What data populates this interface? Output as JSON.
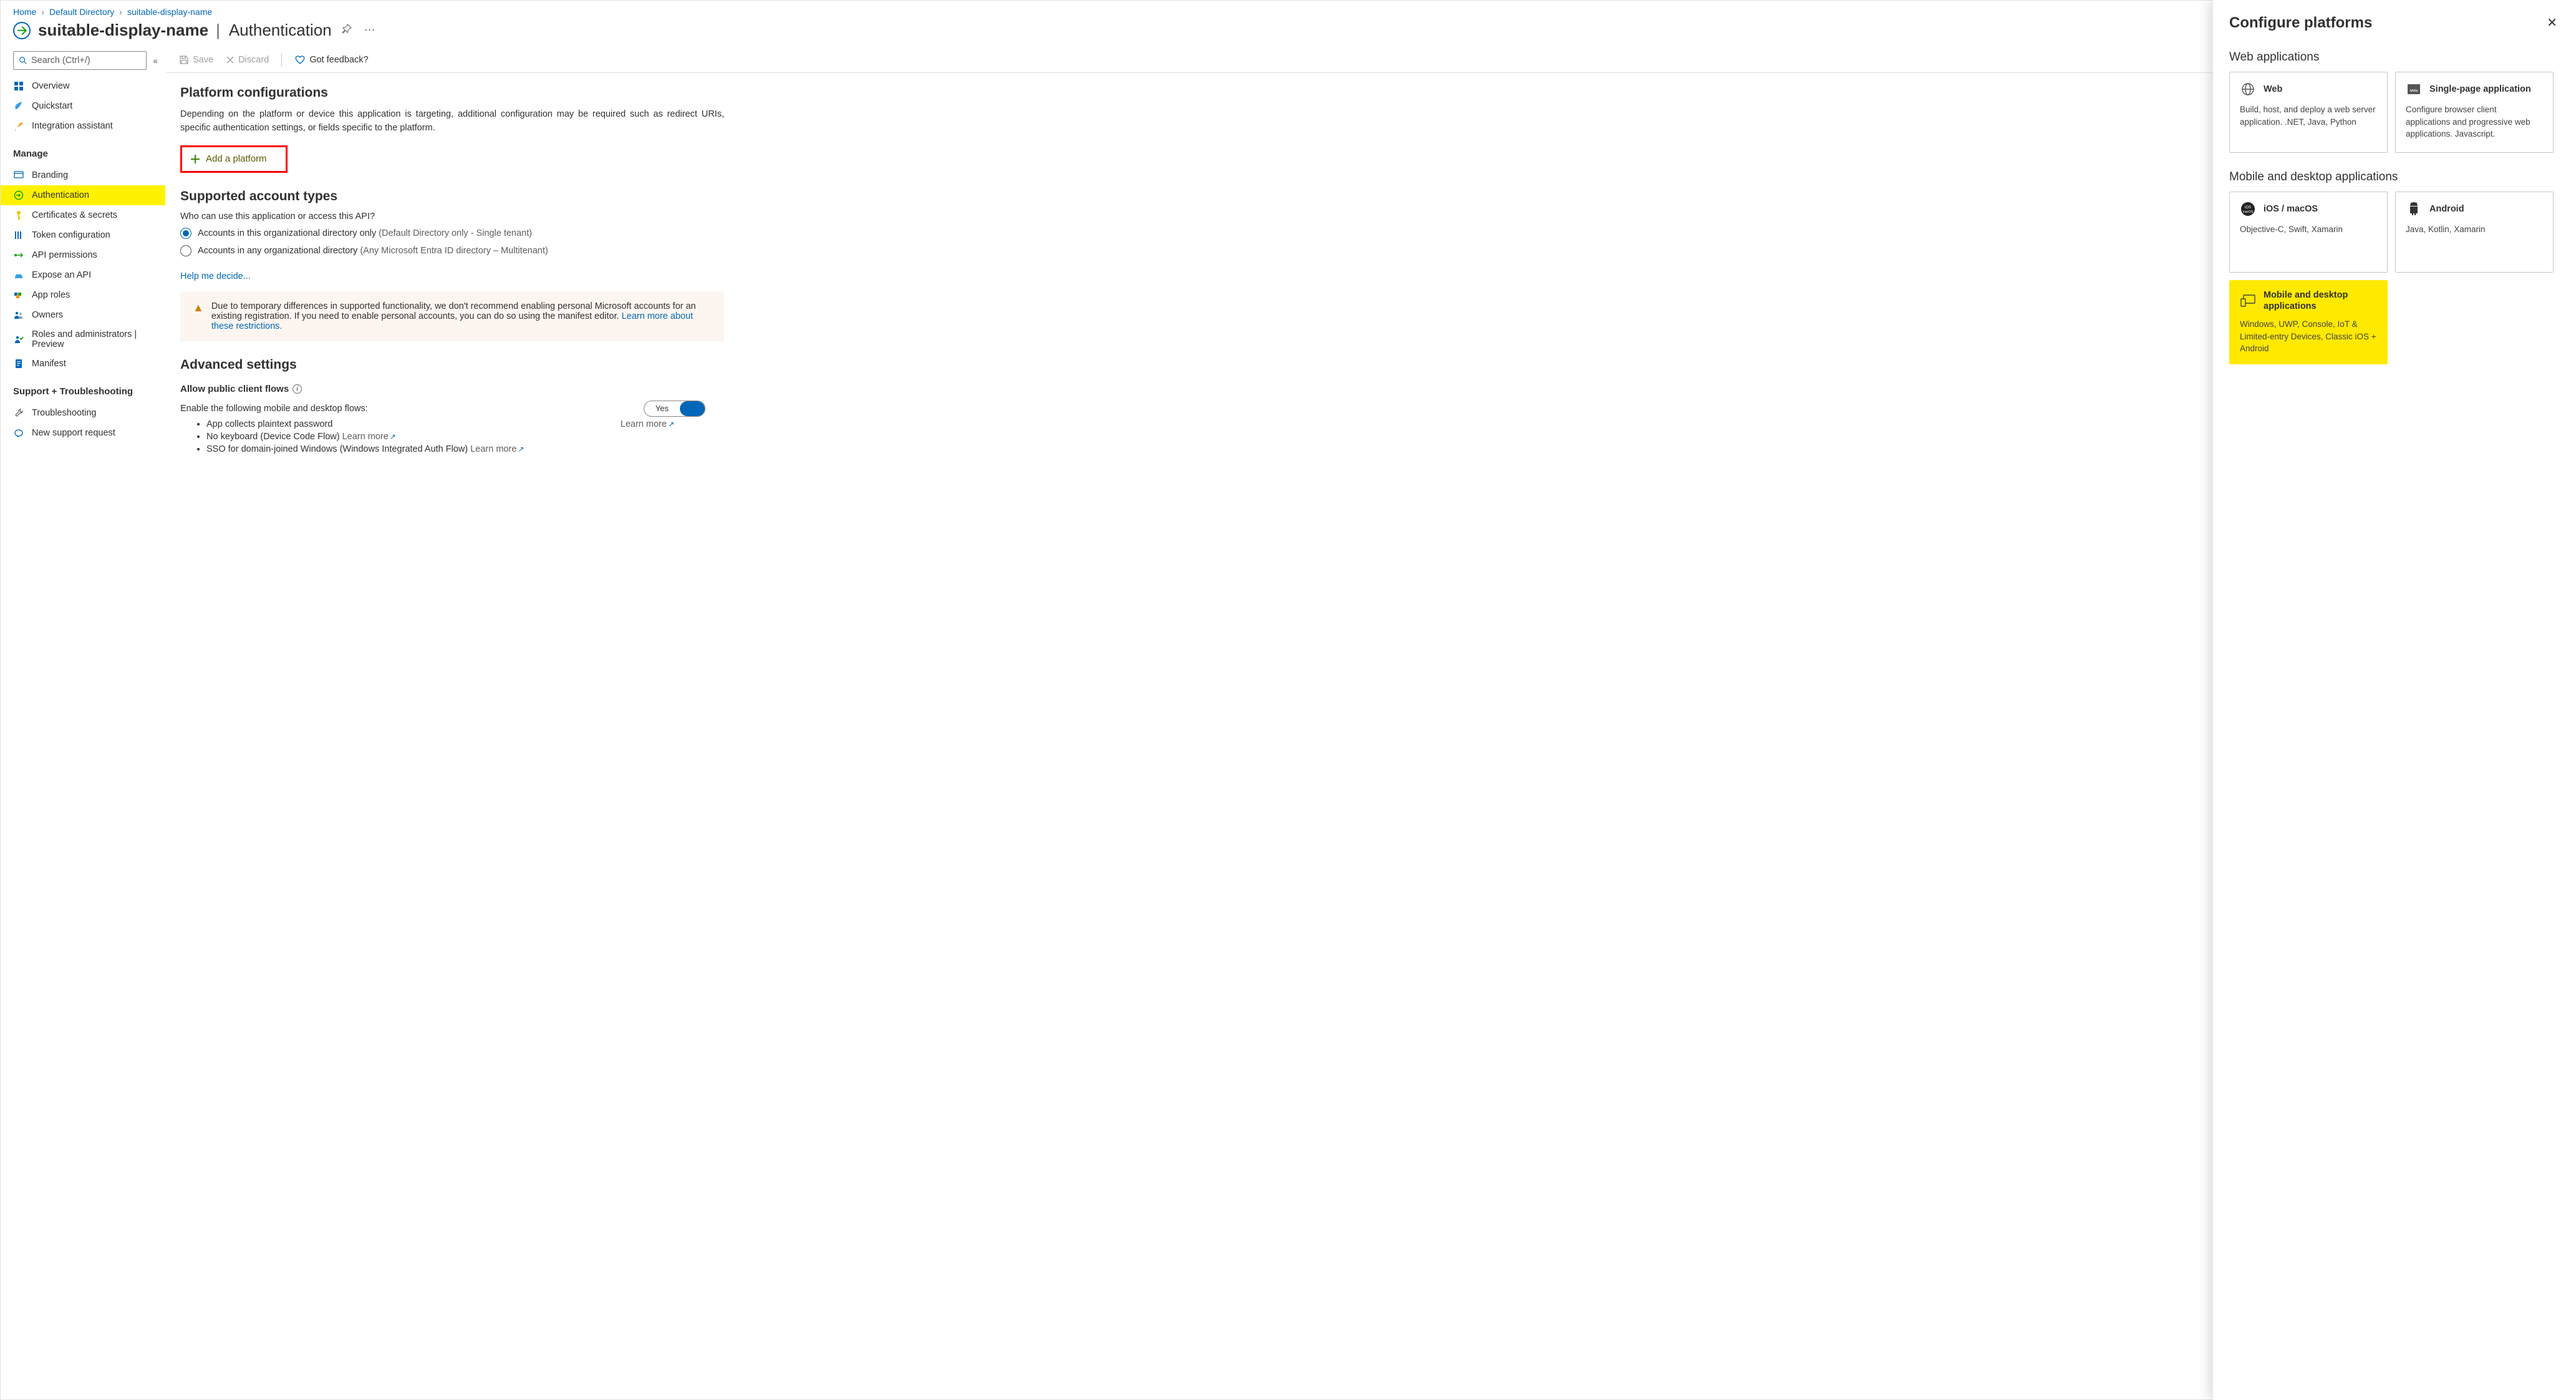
{
  "breadcrumb": {
    "home": "Home",
    "dir": "Default Directory",
    "app": "suitable-display-name"
  },
  "header": {
    "title": "suitable-display-name",
    "subtitle": "Authentication"
  },
  "search": {
    "placeholder": "Search (Ctrl+/)"
  },
  "nav": {
    "top": [
      {
        "label": "Overview"
      },
      {
        "label": "Quickstart"
      },
      {
        "label": "Integration assistant"
      }
    ],
    "manage_heading": "Manage",
    "manage": [
      {
        "label": "Branding"
      },
      {
        "label": "Authentication",
        "selected": true
      },
      {
        "label": "Certificates & secrets"
      },
      {
        "label": "Token configuration"
      },
      {
        "label": "API permissions"
      },
      {
        "label": "Expose an API"
      },
      {
        "label": "App roles"
      },
      {
        "label": "Owners"
      },
      {
        "label": "Roles and administrators | Preview"
      },
      {
        "label": "Manifest"
      }
    ],
    "support_heading": "Support + Troubleshooting",
    "support": [
      {
        "label": "Troubleshooting"
      },
      {
        "label": "New support request"
      }
    ]
  },
  "cmdbar": {
    "save": "Save",
    "discard": "Discard",
    "feedback": "Got feedback?"
  },
  "platforms": {
    "heading": "Platform configurations",
    "desc": "Depending on the platform or device this application is targeting, additional configuration may be required such as redirect URIs, specific authentication settings, or fields specific to the platform.",
    "add_btn": "Add a platform"
  },
  "accounts": {
    "heading": "Supported account types",
    "question": "Who can use this application or access this API?",
    "opt1_a": "Accounts in this organizational directory only ",
    "opt1_b": "(Default Directory only - Single tenant)",
    "opt2_a": "Accounts in any organizational directory ",
    "opt2_b": "(Any Microsoft Entra ID directory – Multitenant)",
    "help": "Help me decide..."
  },
  "alert": {
    "text": "Due to temporary differences in supported functionality, we don't recommend enabling personal Microsoft accounts for an existing registration. If you need to enable personal accounts, you can do so using the manifest editor. ",
    "link": "Learn more about these restrictions."
  },
  "advanced": {
    "heading": "Advanced settings",
    "allow_label": "Allow public client flows",
    "enable_text": "Enable the following mobile and desktop flows:",
    "toggle": "Yes",
    "b1": "App collects plaintext password",
    "b2": "No keyboard (Device Code Flow)",
    "b3": "SSO for domain-joined Windows (Windows Integrated Auth Flow)",
    "learn": "Learn more"
  },
  "panel": {
    "title": "Configure platforms",
    "web_heading": "Web applications",
    "web": {
      "title": "Web",
      "desc": "Build, host, and deploy a web server application. .NET, Java, Python"
    },
    "spa": {
      "title": "Single-page application",
      "desc": "Configure browser client applications and progressive web applications. Javascript."
    },
    "mobile_heading": "Mobile and desktop applications",
    "ios": {
      "title": "iOS / macOS",
      "desc": "Objective-C, Swift, Xamarin"
    },
    "android": {
      "title": "Android",
      "desc": "Java, Kotlin, Xamarin"
    },
    "desktop": {
      "title": "Mobile and desktop applications",
      "desc": "Windows, UWP, Console, IoT & Limited-entry Devices, Classic iOS + Android"
    }
  }
}
